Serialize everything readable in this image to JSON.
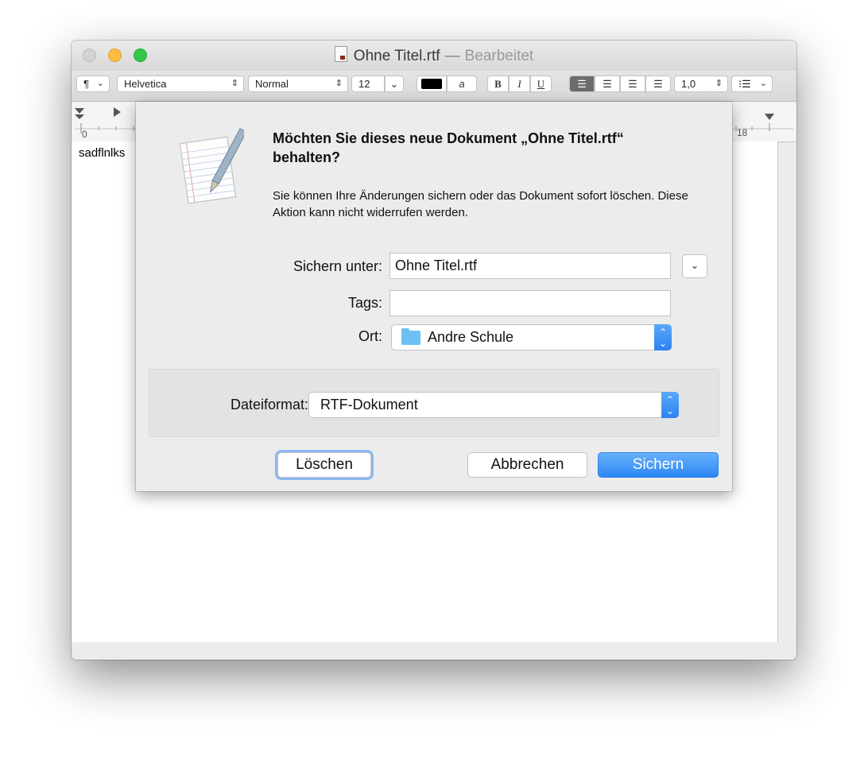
{
  "window": {
    "file_name": "Ohne Titel.rtf",
    "separator": "—",
    "state": "Bearbeitet"
  },
  "toolbar": {
    "paragraph_style": "¶",
    "font_family": "Helvetica",
    "font_style": "Normal",
    "font_size": "12",
    "text_color_label": "a",
    "bold": "B",
    "italic": "I",
    "underline": "U",
    "line_spacing": "1,0",
    "list_label": "⁝☰"
  },
  "ruler": {
    "start_label": "0",
    "end_label": "18"
  },
  "document": {
    "text": "sadflnlks"
  },
  "dialog": {
    "heading": "Möchten Sie dieses neue Dokument „Ohne Titel.rtf“ behalten?",
    "message": "Sie können Ihre Änderungen sichern oder das Dokument sofort löschen. Diese Aktion kann nicht widerrufen werden.",
    "save_as_label": "Sichern unter:",
    "save_as_value": "Ohne Titel.rtf",
    "tags_label": "Tags:",
    "tags_value": "",
    "location_label": "Ort:",
    "location_value": "Andre Schule",
    "format_label": "Dateiformat:",
    "format_value": "RTF-Dokument",
    "delete_button": "Löschen",
    "cancel_button": "Abbrechen",
    "save_button": "Sichern"
  },
  "colors": {
    "accent": "#2c86f4",
    "close": "#d3d3d3",
    "minimize": "#fdbc40",
    "maximize": "#34c84a"
  }
}
